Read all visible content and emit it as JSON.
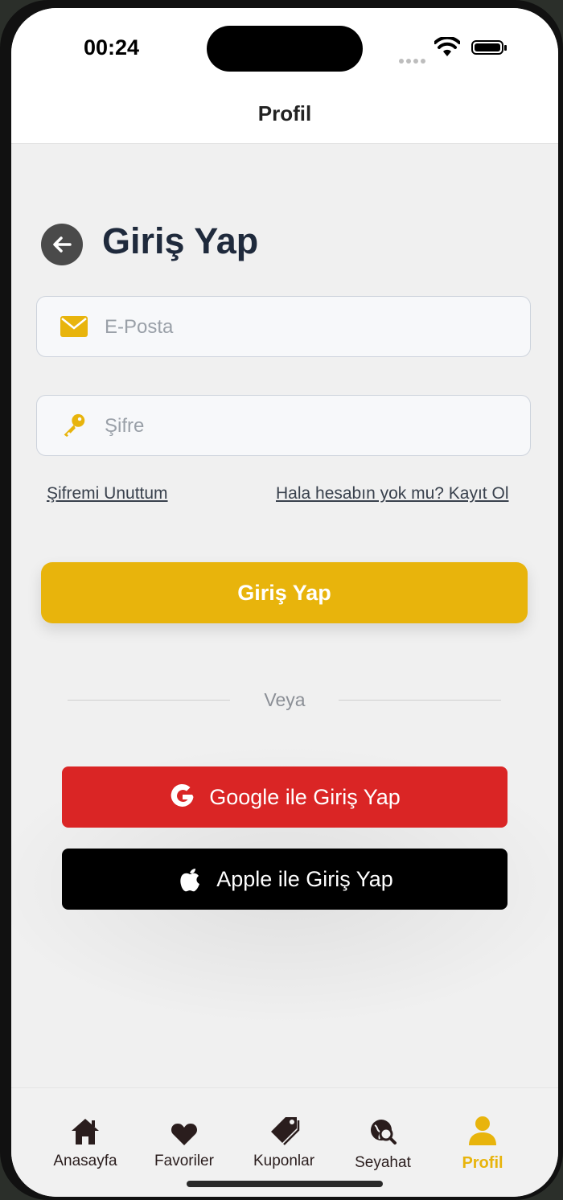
{
  "status_bar": {
    "time": "00:24"
  },
  "nav": {
    "title": "Profil"
  },
  "login": {
    "title": "Giriş Yap",
    "email_placeholder": "E-Posta",
    "password_placeholder": "Şifre",
    "forgot_link": "Şifremi Unuttum",
    "register_link": "Hala hesabın yok mu? Kayıt Ol",
    "submit_label": "Giriş Yap",
    "divider_text": "Veya",
    "google_label": "Google ile Giriş Yap",
    "apple_label": "Apple ile Giriş Yap"
  },
  "tabs": [
    {
      "label": "Anasayfa",
      "icon": "home-icon"
    },
    {
      "label": "Favoriler",
      "icon": "heart-icon"
    },
    {
      "label": "Kuponlar",
      "icon": "tag-icon"
    },
    {
      "label": "Seyahat",
      "icon": "globe-search-icon"
    },
    {
      "label": "Profil",
      "icon": "user-icon",
      "active": true
    }
  ],
  "colors": {
    "accent": "#e8b40c",
    "google": "#da2525",
    "apple": "#000000",
    "title": "#1f2a3c"
  }
}
